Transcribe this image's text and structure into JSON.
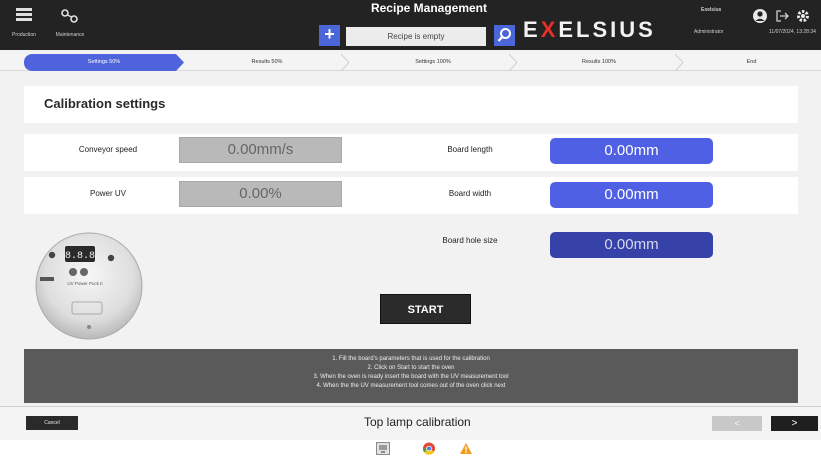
{
  "topbar": {
    "title": "Recipe Management",
    "recipe_field_value": "Recipe is empty",
    "brand_pre": "E",
    "brand_x": "X",
    "brand_post": "ELSIUS",
    "left_buttons": [
      {
        "label": "Production",
        "icon": "menu-icon"
      },
      {
        "label": "Maintenance",
        "icon": "settings-nodes-icon"
      }
    ],
    "user_label": "Exelsius",
    "user_sublabel": "Administrator",
    "datetime": "11/07/2024, 13:28:34",
    "accent_color": "#4a66d8",
    "brand_x_color": "#e63028"
  },
  "steps": [
    {
      "label": "Settings 50%",
      "active": true
    },
    {
      "label": "Results 50%",
      "active": false
    },
    {
      "label": "Settings 100%",
      "active": false
    },
    {
      "label": "Results 100%",
      "active": false
    },
    {
      "label": "End",
      "active": false
    }
  ],
  "section": {
    "title": "Calibration settings"
  },
  "fields": {
    "conveyor_speed_label": "Conveyor speed",
    "conveyor_speed_value": "0.00mm/s",
    "power_uv_label": "Power UV",
    "power_uv_value": "0.00%",
    "board_length_label": "Board length",
    "board_length_value": "0.00mm",
    "board_width_label": "Board width",
    "board_width_value": "0.00mm",
    "board_hole_size_label": "Board hole size",
    "board_hole_size_value": "0.00mm"
  },
  "device": {
    "display": "8.8.8",
    "caption": "UV Power Puck II"
  },
  "start_label": "START",
  "instructions": [
    "1. Fill the board's parameters that is used for the calibration",
    "2. Click on Start to start the oven",
    "3. When the oven is ready insert the board with the UV measurement tool",
    "4. When the the UV measurement tool comes out of the oven click next"
  ],
  "footer": {
    "cancel_label": "Cancel",
    "title": "Top lamp calibration",
    "prev_label": "<",
    "next_label": ">"
  },
  "status_icons": [
    "monitor-icon",
    "chrome-icon",
    "warning-icon"
  ]
}
